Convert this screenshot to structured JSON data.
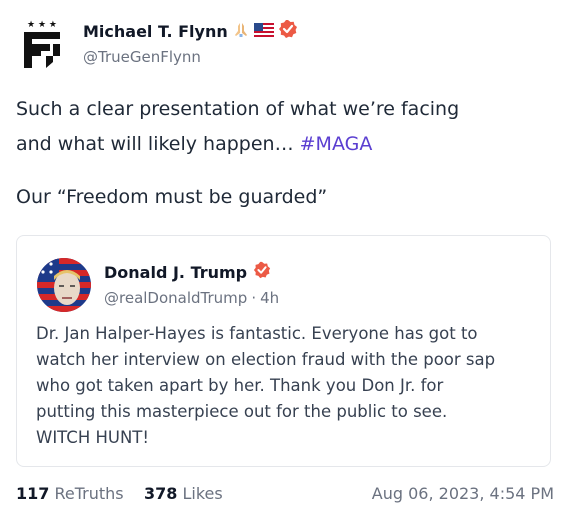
{
  "author": {
    "name": "Michael T. Flynn",
    "handle": "@TrueGenFlynn",
    "name_emojis": [
      "praying-hands",
      "us-flag"
    ],
    "verified": true,
    "verified_color": "#ec5a45"
  },
  "post": {
    "lines": [
      "Such a clear presentation of what we’re facing",
      "and what will likely happen… "
    ],
    "hashtag": "#MAGA",
    "paragraph2": "Our “Freedom must be guarded”",
    "hashtag_color": "#5b3fd1"
  },
  "quote": {
    "name": "Donald J. Trump",
    "handle": "@realDonaldTrump",
    "separator": "·",
    "time": "4h",
    "verified": true,
    "lines": [
      "Dr. Jan Halper-Hayes is fantastic. Everyone has got to",
      "watch her interview on election fraud with the poor sap",
      "who got taken apart by her. Thank you Don Jr. for",
      "putting this masterpiece out for the public to see.",
      "WITCH HUNT!"
    ]
  },
  "footer": {
    "retruths_count": "117",
    "retruths_label": "ReTruths",
    "likes_count": "378",
    "likes_label": "Likes",
    "timestamp": "Aug 06, 2023, 4:54 PM"
  }
}
